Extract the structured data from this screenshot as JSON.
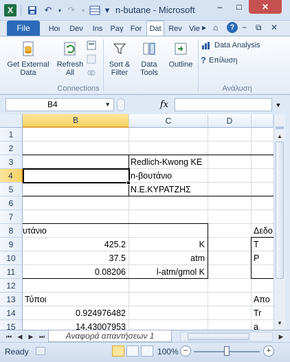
{
  "window": {
    "title": "n-butane - Microsoft",
    "min_glyph": "–",
    "max_glyph": "□",
    "close_glyph": "✕"
  },
  "qat": {
    "logo": "X",
    "save_glyph": "💾",
    "undo_glyph": "↶",
    "redo_glyph": "↷",
    "customize_glyph": "▾"
  },
  "tabs": {
    "file": "File",
    "items": [
      "Hoι",
      "Deν",
      "Ins",
      "Paγ",
      "For",
      "Dat",
      "Rev",
      "Vie"
    ],
    "active_index": 5,
    "more_glyph": "▸",
    "right_icons": [
      "⌂",
      "?",
      "−",
      "⧉",
      "✕"
    ]
  },
  "ribbon": {
    "get_external": "Get External\nData",
    "refresh": "Refresh\nAll",
    "sort_filter": "Sort &\nFilter",
    "data_tools": "Data\nTools",
    "outline": "Outline",
    "data_analysis": "Data Analysis",
    "solver": "Επίλυση",
    "group_connections": "Connections",
    "group_analysis": "Ανάλυση"
  },
  "formula_bar": {
    "name_box": "B4",
    "fx": "fx",
    "formula": ""
  },
  "grid": {
    "columns": [
      "B",
      "C",
      "D"
    ],
    "selected_column": "B",
    "rows": [
      "1",
      "2",
      "3",
      "4",
      "5",
      "6",
      "7",
      "8",
      "9",
      "10",
      "11",
      "12",
      "13",
      "14",
      "15"
    ],
    "selected_row": "4",
    "cells": {
      "C3": "Redlich-Kwong  KE",
      "C4": "n-βουτάνιο",
      "C5": "Ν.Ε.ΚΥΡΑΤΖΗΣ",
      "B8": "υτάνιο",
      "E8": "Δεδο",
      "B9": "425.2",
      "C9": "K",
      "E9": "T",
      "B10": "37.5",
      "C10": "atm",
      "E10": "P",
      "B11": "0.08206",
      "C11": "l-atm/gmol K",
      "B13": "Τύποι",
      "E13": "Απο",
      "B14": "0.924976482",
      "E14": "Tr",
      "B15": "14.43007953",
      "E15": "a"
    }
  },
  "sheets": {
    "active": "Αναφορά απαντήσεων 1"
  },
  "status": {
    "text": "Ready",
    "zoom": "100%",
    "zoom_level": 100
  },
  "colors": {
    "file_tab": "#2a6ab8",
    "excel_green": "#1d7044",
    "selection_header": "#f8d365"
  }
}
